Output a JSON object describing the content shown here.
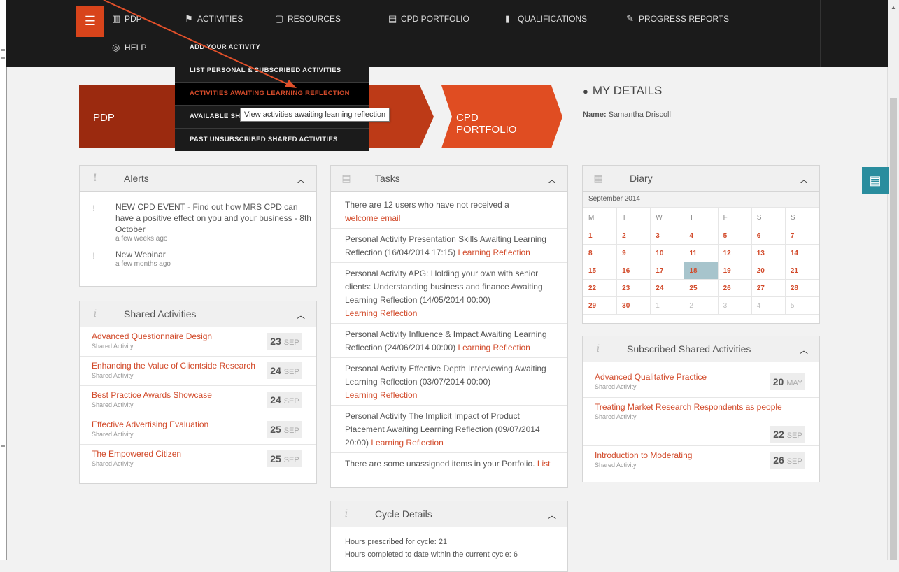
{
  "nav": {
    "items": [
      {
        "label": "PDP",
        "icon": "book-icon"
      },
      {
        "label": "ACTIVITIES",
        "icon": "flag-icon"
      },
      {
        "label": "RESOURCES",
        "icon": "folder-icon"
      },
      {
        "label": "CPD PORTFOLIO",
        "icon": "clipboard-icon"
      },
      {
        "label": "QUALIFICATIONS",
        "icon": "document-icon"
      },
      {
        "label": "PROGRESS REPORTS",
        "icon": "edit-icon"
      },
      {
        "label": "HELP",
        "icon": "lifebuoy-icon"
      }
    ]
  },
  "dropdown": {
    "items": [
      "ADD YOUR ACTIVITY",
      "LIST PERSONAL & SUBSCRIBED ACTIVITIES",
      "ACTIVITIES AWAITING LEARNING REFLECTION",
      "AVAILABLE SHARED ACTIVITIES",
      "PAST UNSUBSCRIBED SHARED ACTIVITIES"
    ],
    "tooltip": "View activities awaiting learning reflection"
  },
  "banner": {
    "pdp": "PDP",
    "cpd": "CPD PORTFOLIO"
  },
  "my_details": {
    "title": "MY DETAILS",
    "name_label": "Name:",
    "name": "Samantha Driscoll"
  },
  "alerts": {
    "title": "Alerts",
    "items": [
      {
        "text": "NEW CPD EVENT - Find out how MRS CPD can have a positive effect on you and your business - 8th October",
        "ago": "a few weeks ago"
      },
      {
        "text": "New Webinar",
        "ago": "a few months ago"
      }
    ]
  },
  "shared": {
    "title": "Shared Activities",
    "items": [
      {
        "title": "Advanced Questionnaire Design",
        "sub": "Shared Activity",
        "day": "23",
        "month": "SEP"
      },
      {
        "title": "Enhancing the Value of Clientside Research",
        "sub": "Shared Activity",
        "day": "24",
        "month": "SEP"
      },
      {
        "title": "Best Practice Awards Showcase",
        "sub": "Shared Activity",
        "day": "24",
        "month": "SEP"
      },
      {
        "title": "Effective Advertising Evaluation",
        "sub": "Shared Activity",
        "day": "25",
        "month": "SEP"
      },
      {
        "title": "The Empowered Citizen",
        "sub": "Shared Activity",
        "day": "25",
        "month": "SEP"
      }
    ]
  },
  "tasks": {
    "title": "Tasks",
    "t1_a": "There are 12 users who have not received a",
    "t1_link": "welcome email",
    "t2_a": "Personal Activity Presentation Skills Awaiting Learning Reflection (16/04/2014 17:15)",
    "t3_a": "Personal Activity APG: Holding your own with senior clients: Understanding business and finance Awaiting Learning Reflection (14/05/2014 00:00)",
    "t4_a": "Personal Activity Influence & Impact Awaiting Learning Reflection (24/06/2014 00:00)",
    "t5_a": "Personal Activity Effective Depth Interviewing Awaiting Learning Reflection (03/07/2014 00:00)",
    "t6_a": "Personal Activity The Implicit Impact of Product Placement Awaiting Learning Reflection (09/07/2014 20:00)",
    "reflect_link": "Learning Reflection",
    "t7_a": "There are some unassigned items in your Portfolio.",
    "t7_link": "List"
  },
  "cycle": {
    "title": "Cycle Details",
    "line1": "Hours prescribed for cycle: 21",
    "line2": "Hours completed to date within the current cycle: 6"
  },
  "diary": {
    "title": "Diary",
    "month": "September 2014",
    "weekdays": [
      "M",
      "T",
      "W",
      "T",
      "F",
      "S",
      "S"
    ],
    "weeks": [
      [
        "1",
        "2",
        "3",
        "4",
        "5",
        "6",
        "7"
      ],
      [
        "8",
        "9",
        "10",
        "11",
        "12",
        "13",
        "14"
      ],
      [
        "15",
        "16",
        "17",
        "18",
        "19",
        "20",
        "21"
      ],
      [
        "22",
        "23",
        "24",
        "25",
        "26",
        "27",
        "28"
      ],
      [
        "29",
        "30",
        "1",
        "2",
        "3",
        "4",
        "5"
      ]
    ],
    "today": "18"
  },
  "subscribed": {
    "title": "Subscribed Shared Activities",
    "items": [
      {
        "title": "Advanced Qualitative Practice",
        "sub": "Shared Activity",
        "day": "20",
        "month": "MAY"
      },
      {
        "title": "Treating Market Research Respondents as people",
        "sub": "Shared Activity",
        "day": "22",
        "month": "SEP"
      },
      {
        "title": "Introduction to Moderating",
        "sub": "Shared Activity",
        "day": "26",
        "month": "SEP"
      }
    ]
  },
  "colors": {
    "accent": "#d24a2a",
    "nav_bg": "#1b1b1b",
    "banner_dark": "#9b2a0f",
    "banner_light": "#e04d22",
    "fab": "#2a8d9e"
  }
}
